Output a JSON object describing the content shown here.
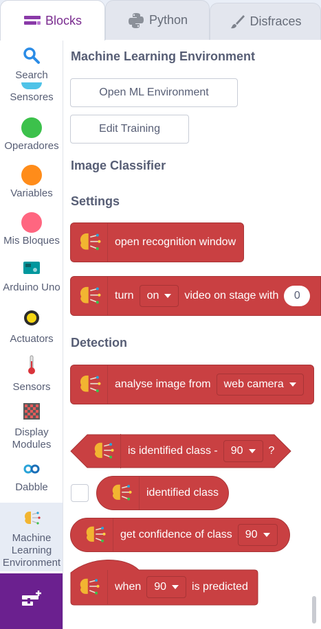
{
  "tabs": [
    {
      "label": "Blocks",
      "icon": "blocks-icon",
      "active": true
    },
    {
      "label": "Python",
      "icon": "python-icon",
      "active": false
    },
    {
      "label": "Disfraces",
      "icon": "brush-icon",
      "active": false
    }
  ],
  "sidebar": {
    "search_label": "Search",
    "items": [
      {
        "label": "Sensores",
        "icon": "sensores-dot",
        "color": "#4fc3e8"
      },
      {
        "label": "Operadores",
        "icon": "operadores-dot",
        "color": "#3cc14b"
      },
      {
        "label": "Variables",
        "icon": "variables-dot",
        "color": "#ff8c1a"
      },
      {
        "label": "Mis Bloques",
        "icon": "mis-bloques-dot",
        "color": "#ff6680"
      },
      {
        "label": "Arduino Uno",
        "icon": "arduino-icon",
        "color": "#00979d"
      },
      {
        "label": "Actuators",
        "icon": "actuator-icon",
        "color": "#f5d614"
      },
      {
        "label": "Sensors",
        "icon": "thermometer-icon",
        "color": "#d9343b"
      },
      {
        "label": "Display Modules",
        "icon": "led-matrix-icon",
        "color": "#b23a3a"
      },
      {
        "label": "Dabble",
        "icon": "dabble-icon",
        "color": "#2aa3d8"
      },
      {
        "label": "Machine Learning Environment",
        "icon": "brain-icon",
        "color": "#f2b531"
      }
    ],
    "extension_icon": "add-extension-icon"
  },
  "palette": {
    "ml_title": "Machine Learning Environment",
    "open_button": "Open ML Environment",
    "edit_button": "Edit Training",
    "image_classifier": "Image Classifier",
    "settings": "Settings",
    "detection": "Detection",
    "blocks": {
      "open_window": "open recognition window",
      "turn": "turn",
      "turn_value": "on",
      "video_text": "video on stage with",
      "transparency": "0",
      "analyse": "analyse image from",
      "analyse_source": "web camera",
      "is_identified": "is identified class -",
      "is_identified_value": "90",
      "question": "?",
      "identified_class": "identified class",
      "get_confidence": "get confidence of class",
      "confidence_value": "90",
      "when": "when",
      "when_value": "90",
      "is_predicted": "is predicted"
    }
  },
  "colors": {
    "block": "#c94042",
    "accent": "#7a2c8f",
    "text": "#575e75"
  }
}
